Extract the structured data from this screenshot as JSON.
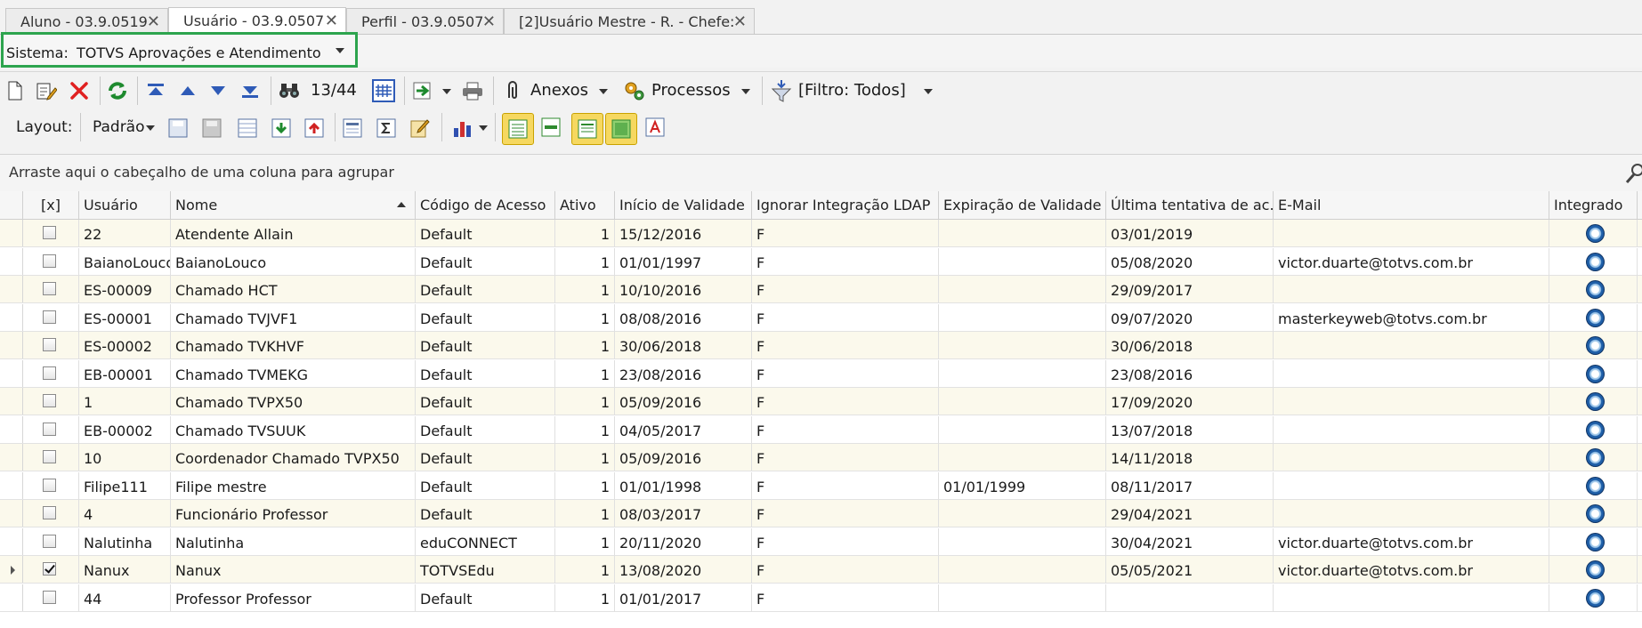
{
  "tabs": [
    {
      "label": "Aluno - 03.9.0519",
      "active": false
    },
    {
      "label": "Usuário - 03.9.0507",
      "active": true
    },
    {
      "label": "Perfil - 03.9.0507",
      "active": false
    },
    {
      "label": "[2]Usuário Mestre - R. - Chefe:",
      "active": false
    }
  ],
  "system": {
    "label": "Sistema:",
    "value": "TOTVS Aprovações e Atendimento"
  },
  "toolbar": {
    "record_position": "13/44",
    "anexos_label": "Anexos",
    "processos_label": "Processos",
    "filtro_label": "[Filtro: Todos]"
  },
  "layout_bar": {
    "label": "Layout:",
    "padrao_label": "Padrão"
  },
  "group_panel": {
    "hint": "Arraste aqui o cabeçalho de uma coluna para agrupar"
  },
  "grid": {
    "columns": [
      "[x]",
      "Usuário",
      "Nome",
      "Código de Acesso",
      "Ativo",
      "Início de Validade",
      "Ignorar Integração LDAP",
      "Expiração de Validade",
      "Última tentativa de ac...",
      "E-Mail",
      "Integrado"
    ],
    "rows": [
      {
        "checked": false,
        "usuario": "22",
        "nome": "Atendente Allain",
        "codigo": "Default",
        "ativo": "1",
        "inicio": "15/12/2016",
        "ignorar": "F",
        "expiracao": "",
        "ultima": "03/01/2019",
        "email": ""
      },
      {
        "checked": false,
        "usuario": "BaianoLouco",
        "nome": "BaianoLouco",
        "codigo": "Default",
        "ativo": "1",
        "inicio": "01/01/1997",
        "ignorar": "F",
        "expiracao": "",
        "ultima": "05/08/2020",
        "email": "victor.duarte@totvs.com.br"
      },
      {
        "checked": false,
        "usuario": "ES-00009",
        "nome": "Chamado HCT",
        "codigo": "Default",
        "ativo": "1",
        "inicio": "10/10/2016",
        "ignorar": "F",
        "expiracao": "",
        "ultima": "29/09/2017",
        "email": ""
      },
      {
        "checked": false,
        "usuario": "ES-00001",
        "nome": "Chamado TVJVF1",
        "codigo": "Default",
        "ativo": "1",
        "inicio": "08/08/2016",
        "ignorar": "F",
        "expiracao": "",
        "ultima": "09/07/2020",
        "email": "masterkeyweb@totvs.com.br"
      },
      {
        "checked": false,
        "usuario": "ES-00002",
        "nome": "Chamado TVKHVF",
        "codigo": "Default",
        "ativo": "1",
        "inicio": "30/06/2018",
        "ignorar": "F",
        "expiracao": "",
        "ultima": "30/06/2018",
        "email": ""
      },
      {
        "checked": false,
        "usuario": "EB-00001",
        "nome": "Chamado TVMEKG",
        "codigo": "Default",
        "ativo": "1",
        "inicio": "23/08/2016",
        "ignorar": "F",
        "expiracao": "",
        "ultima": "23/08/2016",
        "email": ""
      },
      {
        "checked": false,
        "usuario": "1",
        "nome": "Chamado TVPX50",
        "codigo": "Default",
        "ativo": "1",
        "inicio": "05/09/2016",
        "ignorar": "F",
        "expiracao": "",
        "ultima": "17/09/2020",
        "email": ""
      },
      {
        "checked": false,
        "usuario": "EB-00002",
        "nome": "Chamado TVSUUK",
        "codigo": "Default",
        "ativo": "1",
        "inicio": "04/05/2017",
        "ignorar": "F",
        "expiracao": "",
        "ultima": "13/07/2018",
        "email": ""
      },
      {
        "checked": false,
        "usuario": "10",
        "nome": "Coordenador Chamado TVPX50",
        "codigo": "Default",
        "ativo": "1",
        "inicio": "05/09/2016",
        "ignorar": "F",
        "expiracao": "",
        "ultima": "14/11/2018",
        "email": ""
      },
      {
        "checked": false,
        "usuario": "Filipe111",
        "nome": "Filipe mestre",
        "codigo": "Default",
        "ativo": "1",
        "inicio": "01/01/1998",
        "ignorar": "F",
        "expiracao": "01/01/1999",
        "ultima": "08/11/2017",
        "email": ""
      },
      {
        "checked": false,
        "usuario": "4",
        "nome": "Funcionário Professor",
        "codigo": "Default",
        "ativo": "1",
        "inicio": "08/03/2017",
        "ignorar": "F",
        "expiracao": "",
        "ultima": "29/04/2021",
        "email": ""
      },
      {
        "checked": false,
        "usuario": "Nalutinha",
        "nome": "Nalutinha",
        "codigo": "eduCONNECT",
        "ativo": "1",
        "inicio": "20/11/2020",
        "ignorar": "F",
        "expiracao": "",
        "ultima": "30/04/2021",
        "email": "victor.duarte@totvs.com.br"
      },
      {
        "checked": true,
        "usuario": "Nanux",
        "nome": "Nanux",
        "codigo": "TOTVSEdu",
        "ativo": "1",
        "inicio": "13/08/2020",
        "ignorar": "F",
        "expiracao": "",
        "ultima": "05/05/2021",
        "email": "victor.duarte@totvs.com.br"
      },
      {
        "checked": false,
        "usuario": "44",
        "nome": "Professor Professor",
        "codigo": "Default",
        "ativo": "1",
        "inicio": "01/01/2017",
        "ignorar": "F",
        "expiracao": "",
        "ultima": "",
        "email": ""
      }
    ]
  },
  "colors": {
    "highlight_border": "#2da44e",
    "odd_row": "#fbf9ec",
    "layout_active": "#f6d860"
  }
}
